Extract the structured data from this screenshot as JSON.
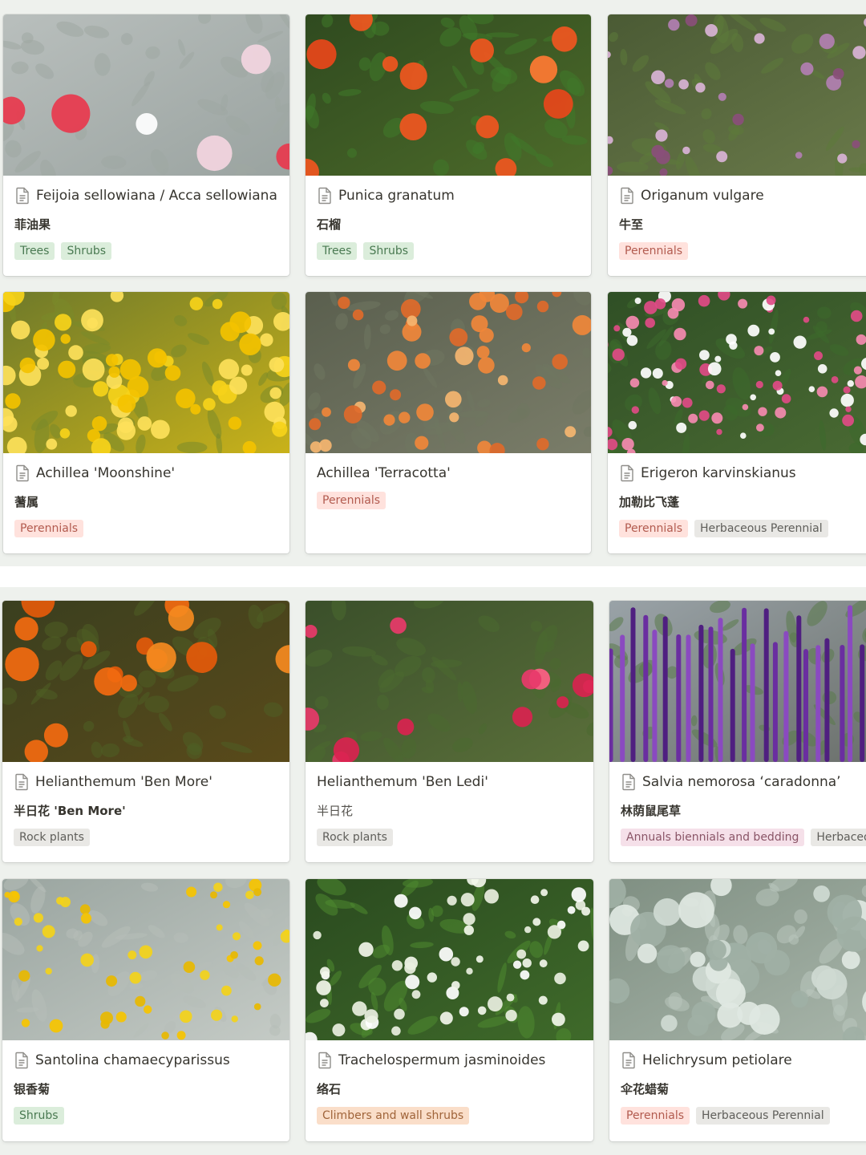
{
  "cards": [
    {
      "title": "Feijoia sellowiana / Acca sellowiana",
      "subtitle": "菲油果",
      "tags": [
        "Trees",
        "Shrubs"
      ],
      "image": "feijoa-flower-photo"
    },
    {
      "title": "Punica granatum",
      "subtitle": "石榴",
      "tags": [
        "Trees",
        "Shrubs"
      ],
      "image": "pomegranate-flower-photo"
    },
    {
      "title": "Origanum vulgare",
      "subtitle": "牛至",
      "tags": [
        "Perennials"
      ],
      "image": "oregano-flower-photo"
    },
    {
      "title": "Achillea 'Moonshine'",
      "subtitle": "蓍属",
      "tags": [
        "Perennials"
      ],
      "image": "yellow-yarrow-photo"
    },
    {
      "title": "Achillea 'Terracotta'",
      "subtitle": "",
      "tags": [
        "Perennials"
      ],
      "image": "terracotta-yarrow-photo"
    },
    {
      "title": "Erigeron karvinskianus",
      "subtitle": "加勒比飞蓬",
      "tags": [
        "Perennials",
        "Herbaceous Perennial"
      ],
      "image": "erigeron-daisies-photo"
    },
    {
      "title": "Helianthemum 'Ben More'",
      "subtitle": "半日花 'Ben More'",
      "tags": [
        "Rock plants"
      ],
      "image": "orange-rockrose-photo"
    },
    {
      "title": "Helianthemum 'Ben Ledi'",
      "subtitle": "半日花",
      "tags": [
        "Rock plants"
      ],
      "image": "pink-rockrose-photo"
    },
    {
      "title": "Salvia nemorosa ‘caradonna’",
      "subtitle": "林荫鼠尾草",
      "tags": [
        "Annuals biennials and bedding",
        "Herbaceous Perennial"
      ],
      "image": "purple-salvia-photo"
    },
    {
      "title": "Santolina chamaecyparissus",
      "subtitle": "银香菊",
      "tags": [
        "Shrubs"
      ],
      "image": "santolina-photo"
    },
    {
      "title": "Trachelospermum jasminoides",
      "subtitle": "络石",
      "tags": [
        "Climbers and wall shrubs"
      ],
      "image": "star-jasmine-photo"
    },
    {
      "title": "Helichrysum petiolare",
      "subtitle": "伞花蜡菊",
      "tags": [
        "Perennials",
        "Herbaceous Perennial"
      ],
      "image": "helichrysum-leaves-photo"
    }
  ],
  "tag_colors": {
    "Trees": "green",
    "Shrubs": "green",
    "Perennials": "red",
    "Herbaceous Perennial": "gray",
    "Rock plants": "gray",
    "Annuals biennials and bedding": "pink",
    "Climbers and wall shrubs": "orange"
  },
  "colors": {
    "background": "#edf0ec",
    "card": "#ffffff",
    "text": "#37352f"
  }
}
